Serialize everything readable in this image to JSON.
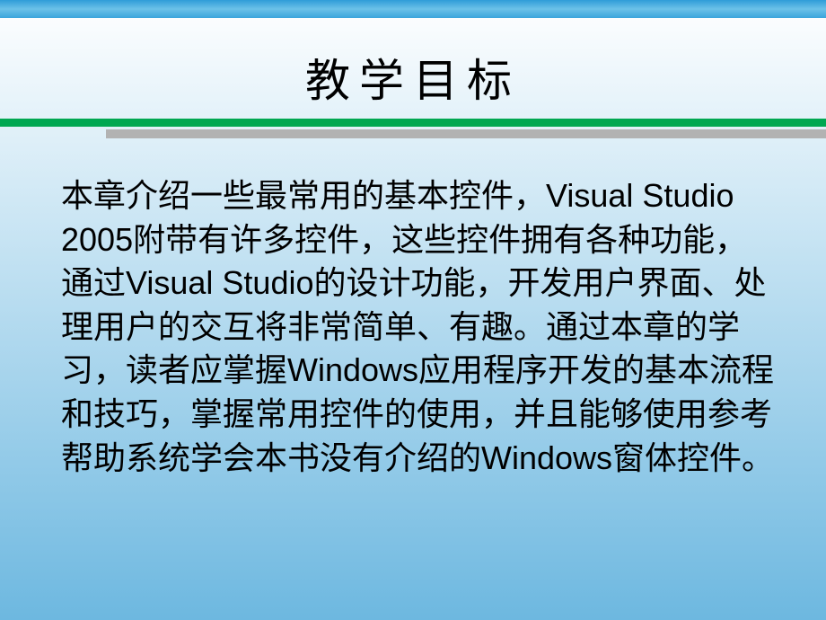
{
  "slide": {
    "title": "教学目标",
    "body": "本章介绍一些最常用的基本控件，Visual Studio 2005附带有许多控件，这些控件拥有各种功能，通过Visual Studio的设计功能，开发用户界面、处理用户的交互将非常简单、有趣。通过本章的学习，读者应掌握Windows应用程序开发的基本流程和技巧，掌握常用控件的使用，并且能够使用参考帮助系统学会本书没有介绍的Windows窗体控件。"
  }
}
